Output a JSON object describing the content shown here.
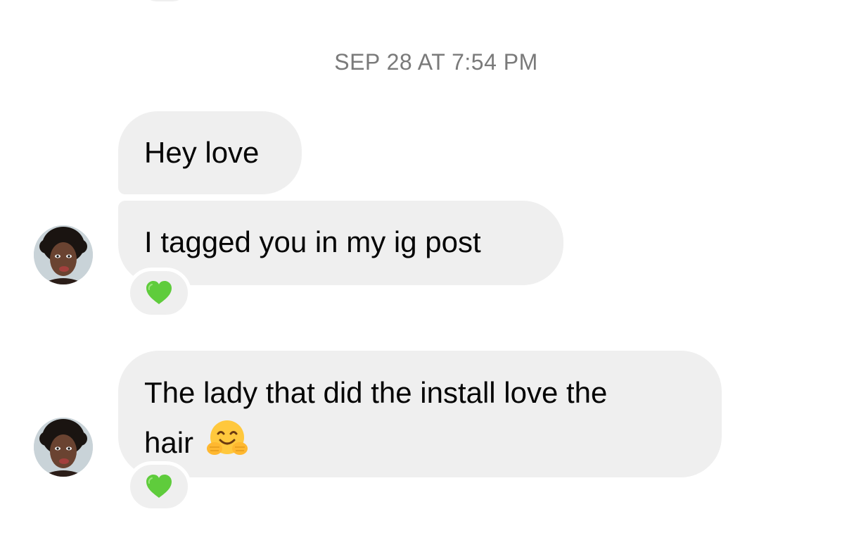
{
  "conversation": {
    "timestamp": "SEP 28 AT 7:54 PM",
    "messages": [
      {
        "text": "Hey love"
      },
      {
        "text": "I tagged you in my ig post",
        "reaction": "green-heart-emoji"
      },
      {
        "text_line1": "The lady that did the install love the",
        "text_line2": "hair",
        "emoji": "hugging-face-emoji",
        "reaction": "green-heart-emoji"
      }
    ]
  },
  "colors": {
    "bubble": "#efefef",
    "timestamp": "#7a7a7a",
    "text": "#050505",
    "reaction_heart": "#5fcc3c"
  }
}
